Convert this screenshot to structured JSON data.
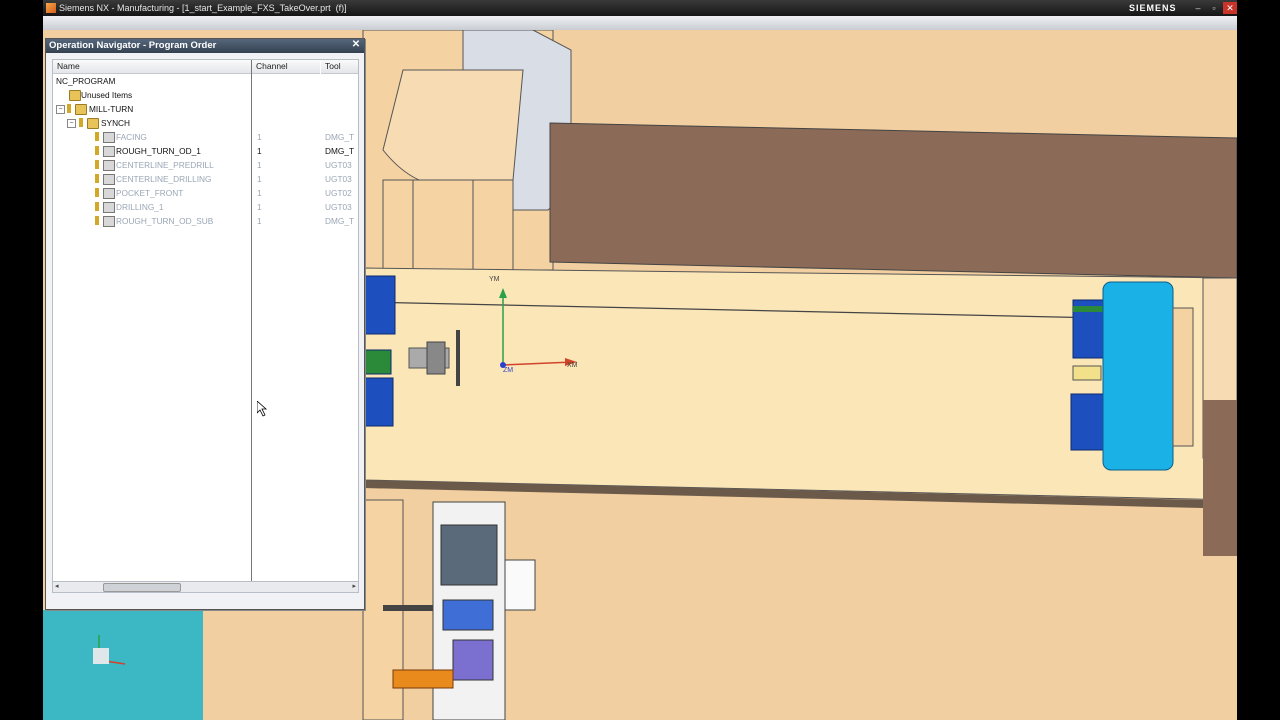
{
  "window": {
    "title": "Siemens NX - Manufacturing - [1_start_Example_FXS_TakeOver.prt  (f)]",
    "brand": "SIEMENS",
    "controls": [
      "–",
      "▫",
      "✕"
    ]
  },
  "navigator": {
    "title": "Operation Navigator - Program Order",
    "close": "✕",
    "columns": {
      "name": "Name",
      "channel": "Channel",
      "tool": "Tool"
    },
    "rows": [
      {
        "name": "NC_PROGRAM",
        "channel": "",
        "tool": "",
        "style": "bright"
      },
      {
        "name": "Unused Items",
        "channel": "",
        "tool": "",
        "style": "bright"
      },
      {
        "name": "MILL-TURN",
        "channel": "",
        "tool": "",
        "style": "bright"
      },
      {
        "name": "SYNCH",
        "channel": "",
        "tool": "",
        "style": "bright"
      },
      {
        "name": "FACING",
        "channel": "1",
        "tool": "DMG_T",
        "style": "dim"
      },
      {
        "name": "ROUGH_TURN_OD_1",
        "channel": "1",
        "tool": "DMG_T",
        "style": "bright"
      },
      {
        "name": "CENTERLINE_PREDRILL",
        "channel": "1",
        "tool": "UGT03",
        "style": "dim"
      },
      {
        "name": "CENTERLINE_DRILLING",
        "channel": "1",
        "tool": "UGT03",
        "style": "dim"
      },
      {
        "name": "POCKET_FRONT",
        "channel": "1",
        "tool": "UGT02",
        "style": "dim"
      },
      {
        "name": "DRILLING_1",
        "channel": "1",
        "tool": "UGT03",
        "style": "dim"
      },
      {
        "name": "ROUGH_TURN_OD_SUB",
        "channel": "1",
        "tool": "DMG_T",
        "style": "dim"
      }
    ]
  },
  "scene": {
    "axis_labels": {
      "ym": "YM",
      "xm": "XM",
      "zm": "ZM"
    },
    "colors": {
      "floor": "#f2cfa0",
      "bed": "#fbe6b8",
      "shadow_block": "#8b6a58",
      "chuck": "#1ab2e6",
      "jaw": "#1d4fbf"
    }
  }
}
